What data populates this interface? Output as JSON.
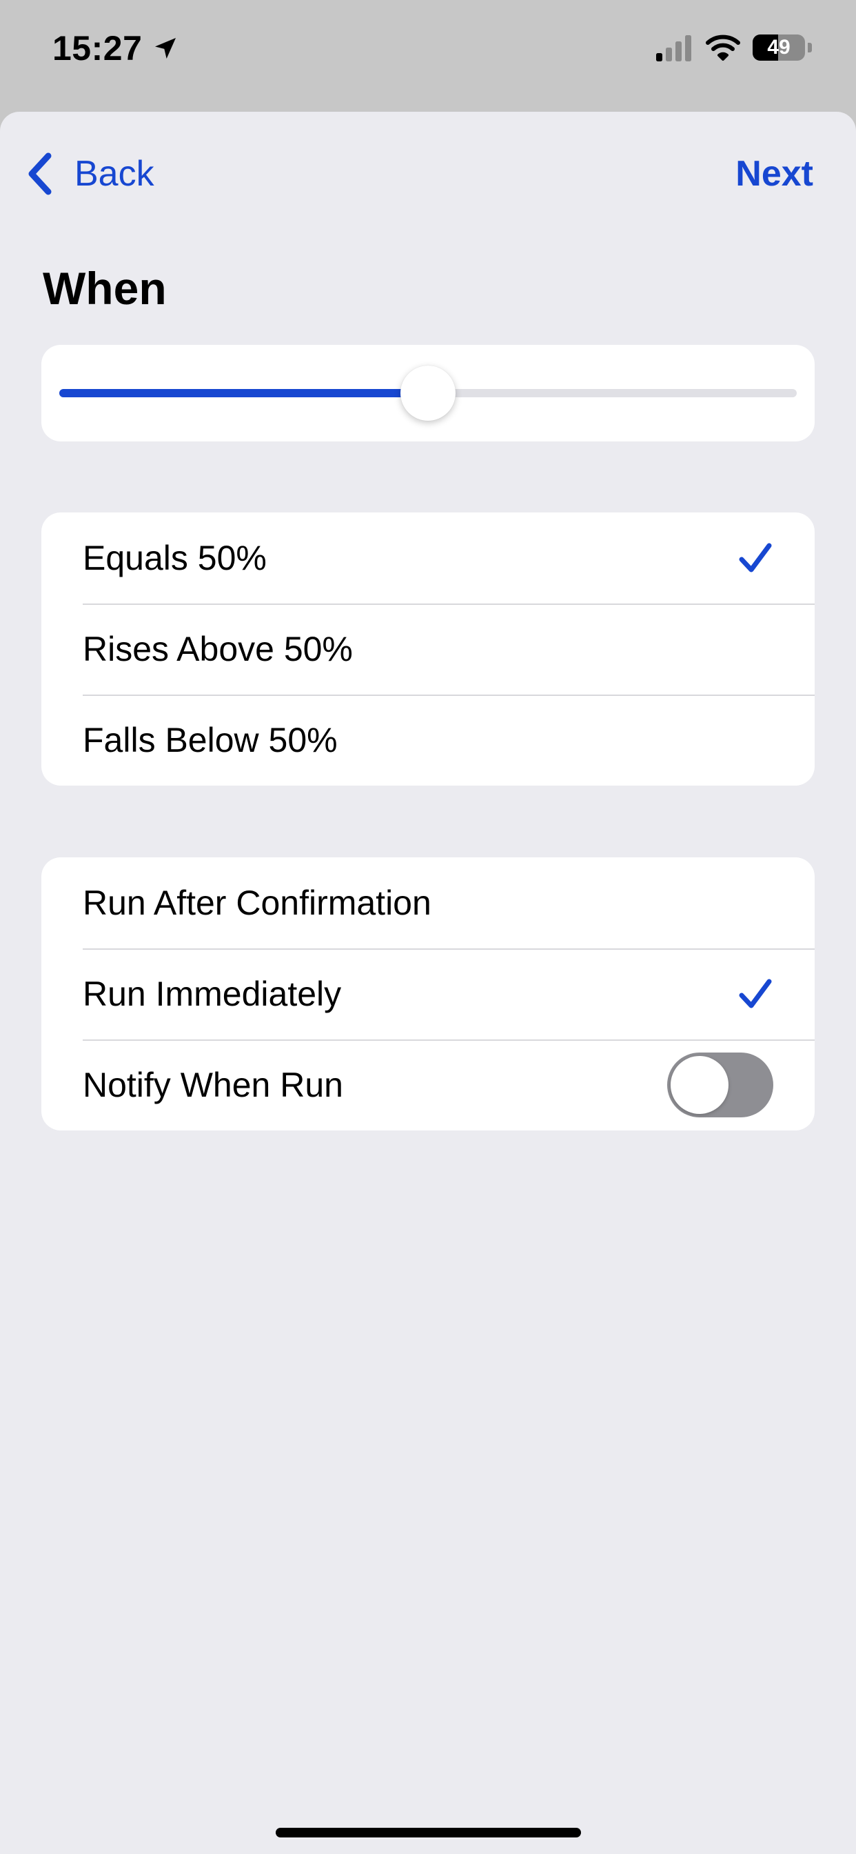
{
  "status_bar": {
    "time": "15:27",
    "battery_percent": "49",
    "battery_level": 0.49,
    "signal_bars_active": 1,
    "signal_bars_total": 4,
    "icons": [
      "location-arrow-icon",
      "cellular-signal-icon",
      "wifi-icon",
      "battery-icon"
    ]
  },
  "nav": {
    "back_label": "Back",
    "next_label": "Next",
    "back_icon": "chevron-left-icon"
  },
  "section": {
    "title": "When"
  },
  "slider": {
    "value": 50,
    "min": 0,
    "max": 100
  },
  "condition_options": [
    {
      "label": "Equals 50%",
      "checked": true
    },
    {
      "label": "Rises Above 50%",
      "checked": false
    },
    {
      "label": "Falls Below 50%",
      "checked": false
    }
  ],
  "run_options": [
    {
      "label": "Run After Confirmation",
      "checked": false
    },
    {
      "label": "Run Immediately",
      "checked": true
    }
  ],
  "notify": {
    "label": "Notify When Run",
    "enabled": false
  },
  "colors": {
    "accent": "#1747d1",
    "background": "#ebebf0",
    "card": "#ffffff",
    "status_bar_bg": "#c7c7c7",
    "separator": "#d8d8dc",
    "toggle_off": "#8e8e93"
  }
}
